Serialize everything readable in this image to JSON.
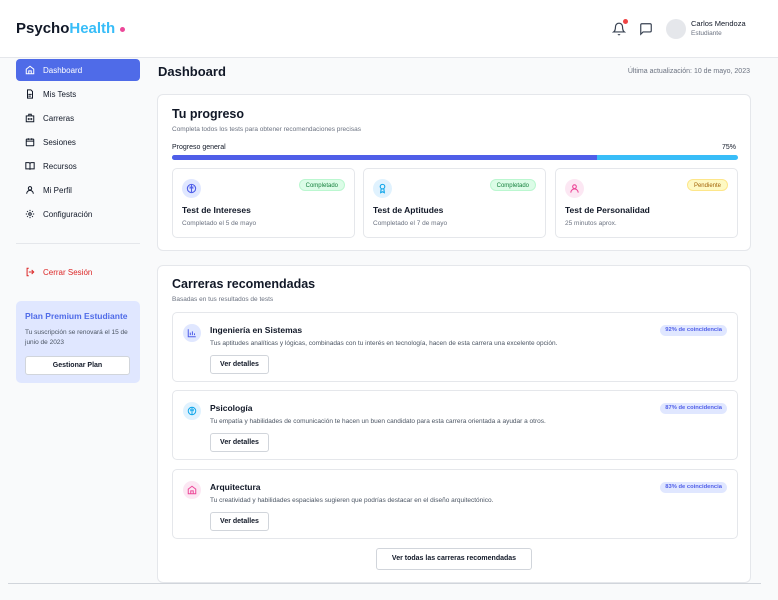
{
  "app": {
    "logo_main": "Psycho",
    "logo_accent": "Health"
  },
  "header": {
    "user_name": "Carlos Mendoza",
    "user_role": "Estudiante"
  },
  "sidebar": {
    "items": [
      {
        "label": "Dashboard",
        "icon": "home-icon"
      },
      {
        "label": "Mis Tests",
        "icon": "document-icon"
      },
      {
        "label": "Carreras",
        "icon": "building-icon"
      },
      {
        "label": "Sesiones",
        "icon": "calendar-icon"
      },
      {
        "label": "Recursos",
        "icon": "book-icon"
      },
      {
        "label": "Mi Perfil",
        "icon": "user-icon"
      },
      {
        "label": "Configuración",
        "icon": "gear-icon"
      }
    ],
    "logout_label": "Cerrar Sesión",
    "plan": {
      "title": "Plan Premium Estudiante",
      "text": "Tu suscripción se renovará el 15 de junio de 2023",
      "button": "Gestionar Plan"
    }
  },
  "main": {
    "title": "Dashboard",
    "last_update": "Última actualización: 10 de mayo, 2023",
    "progress": {
      "title": "Tu progreso",
      "subtitle": "Completa todos los tests para obtener recomendaciones precisas",
      "label": "Progreso general",
      "percent_text": "75%",
      "percent_value": 75,
      "tests": [
        {
          "name": "Test de Intereses",
          "status": "Completado el 5 de mayo",
          "badge": "Completado",
          "icon": "brain-icon"
        },
        {
          "name": "Test de Aptitudes",
          "status": "Completado el 7 de mayo",
          "badge": "Completado",
          "icon": "award-icon"
        },
        {
          "name": "Test de Personalidad",
          "status": "25 minutos aprox.",
          "badge": "Pendiente",
          "icon": "person-icon"
        }
      ]
    },
    "careers": {
      "title": "Carreras recomendadas",
      "subtitle": "Basadas en tus resultados de tests",
      "items": [
        {
          "name": "Ingeniería en Sistemas",
          "desc": "Tus aptitudes analíticas y lógicas, combinadas con tu interés en tecnología, hacen de esta carrera una excelente opción.",
          "match": "92% de coincidencia",
          "button": "Ver detalles",
          "icon": "chart-icon"
        },
        {
          "name": "Psicología",
          "desc": "Tu empatía y habilidades de comunicación te hacen un buen candidato para esta carrera orientada a ayudar a otros.",
          "match": "87% de coincidencia",
          "button": "Ver detalles",
          "icon": "brain-icon"
        },
        {
          "name": "Arquitectura",
          "desc": "Tu creatividad y habilidades espaciales sugieren que podrías destacar en el diseño arquitectónico.",
          "match": "83% de coincidencia",
          "button": "Ver detalles",
          "icon": "home-icon"
        }
      ],
      "all_button": "Ver todas las carreras recomendadas"
    }
  },
  "colors": {
    "primary": "#4f6be8",
    "accent": "#38bdf8",
    "logo_dot": "#ec4899",
    "danger": "#dc2626"
  }
}
